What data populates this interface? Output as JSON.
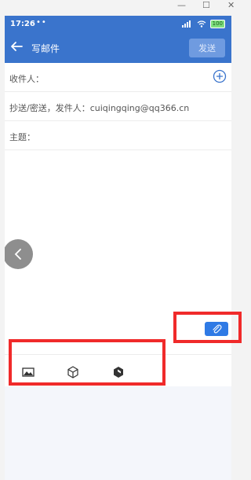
{
  "window": {
    "minimize": "—",
    "maximize": "☐",
    "close": "✕"
  },
  "status_bar": {
    "time": "17:26",
    "dots": "••",
    "signal": "",
    "battery": "100"
  },
  "app_bar": {
    "title": "写邮件",
    "send_label": "发送"
  },
  "form": {
    "to_label": "收件人：",
    "cc_label": "抄送/密送，发件人：cuiqingqing@qq366.cn",
    "subject_label": "主题："
  },
  "colors": {
    "primary": "#3a74cc",
    "send_button": "#6f9be0",
    "attach_button": "#2f7ae5",
    "highlight": "#f02a2a"
  },
  "icons": {
    "back": "arrow-left-icon",
    "add": "plus-circle-icon",
    "attach": "paperclip-icon",
    "image": "image-icon",
    "box": "cube-icon",
    "app": "app-icon"
  }
}
